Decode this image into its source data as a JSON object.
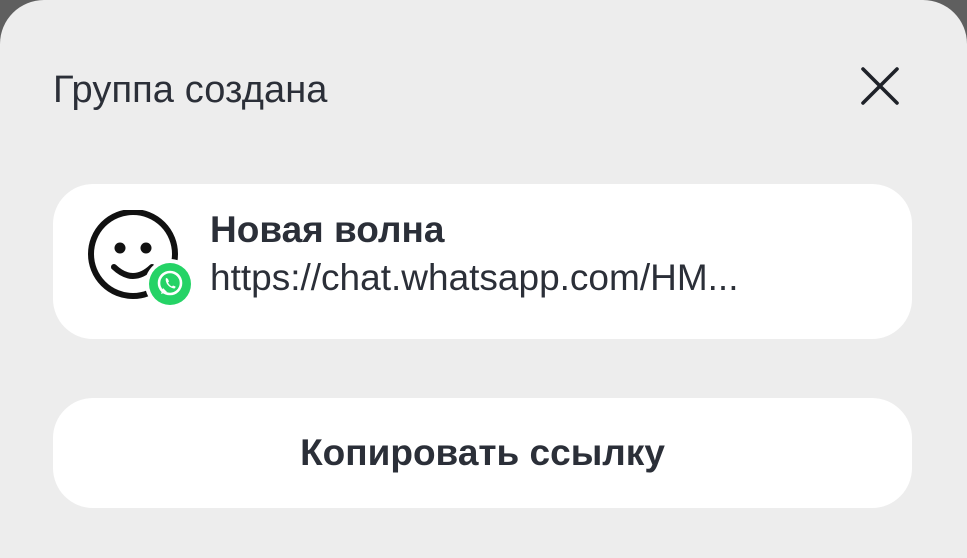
{
  "dialog": {
    "title": "Группа создана",
    "close_icon": "close-icon"
  },
  "group": {
    "name": "Новая волна",
    "link": "https://chat.whatsapp.com/HM...",
    "avatar_icon": "smiley-face-icon",
    "badge_icon": "whatsapp-icon",
    "badge_color": "#25d366"
  },
  "actions": {
    "copy_label": "Копировать ссылку"
  },
  "colors": {
    "dialog_background": "#ededed",
    "card_background": "#ffffff",
    "text": "#2b2f38"
  }
}
